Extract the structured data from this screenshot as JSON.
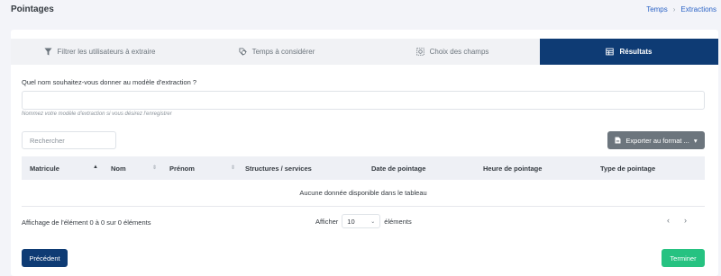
{
  "header": {
    "title": "Pointages",
    "breadcrumb": [
      "Temps",
      "Extractions"
    ]
  },
  "tabs": [
    {
      "label": "Filtrer les utilisateurs à extraire",
      "icon": "filter-icon",
      "active": false
    },
    {
      "label": "Temps à considérer",
      "icon": "time-tag-icon",
      "active": false
    },
    {
      "label": "Choix des champs",
      "icon": "field-select-icon",
      "active": false
    },
    {
      "label": "Résultats",
      "icon": "table-icon",
      "active": true
    }
  ],
  "form": {
    "question": "Quel nom souhaitez-vous donner au modèle d'extraction ?",
    "name_value": "",
    "help": "Nommez votre modèle d'extraction si vous désirez l'enregistrer"
  },
  "search": {
    "placeholder": "Rechercher"
  },
  "export": {
    "label": "Exporter au format ...",
    "caret": "▾",
    "icon": "file-icon"
  },
  "table": {
    "columns": [
      "Matricule",
      "Nom",
      "Prénom",
      "Structures / services",
      "Date de pointage",
      "Heure de pointage",
      "Type de pointage"
    ],
    "empty": "Aucune donnée disponible dans le tableau"
  },
  "footer": {
    "info": "Affichage de l'élément 0 à  0 sur 0 éléments",
    "show_label": "Afficher",
    "page_size": "10",
    "elements_label": "éléments",
    "prev": "‹",
    "next": "›"
  },
  "buttons": {
    "previous": "Précédent",
    "finish": "Terminer"
  },
  "colors": {
    "primary": "#0e3b74",
    "success": "#26c281",
    "secondary": "#6c757d",
    "link": "#2b63c6"
  }
}
